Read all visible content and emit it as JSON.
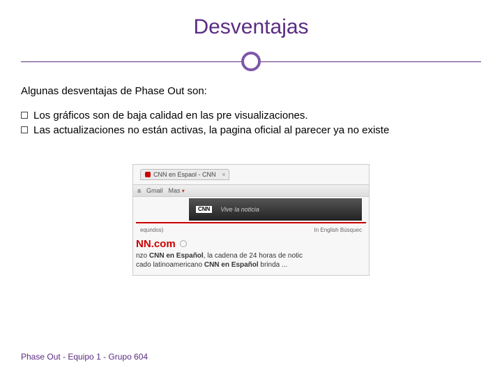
{
  "title": "Desventajas",
  "intro": "Algunas desventajas de Phase Out son:",
  "bullets": [
    "Los gráficos son de baja calidad  en las pre visualizaciones.",
    "Las actualizaciones no están activas, la pagina oficial al parecer ya no existe"
  ],
  "screenshot": {
    "tab": "CNN en Espaol - CNN",
    "toolbar": {
      "item1": "a",
      "item2": "Gmail",
      "item3": "Mas"
    },
    "banner": {
      "logo": "CNN",
      "slogan": "Vive la noticia"
    },
    "mid_left": "equndos)",
    "mid_right": "In English  Búsquec",
    "domain": "NN.com",
    "line1_pre": "nzo ",
    "line1_hl": "CNN en Español",
    "line1_post": ", la cadena de 24 horas de notic",
    "line2_pre": "cado latinoamericano ",
    "line2_hl": "CNN en Español",
    "line2_post": " brinda ..."
  },
  "footer": "Phase Out - Equipo 1 - Grupo 604"
}
